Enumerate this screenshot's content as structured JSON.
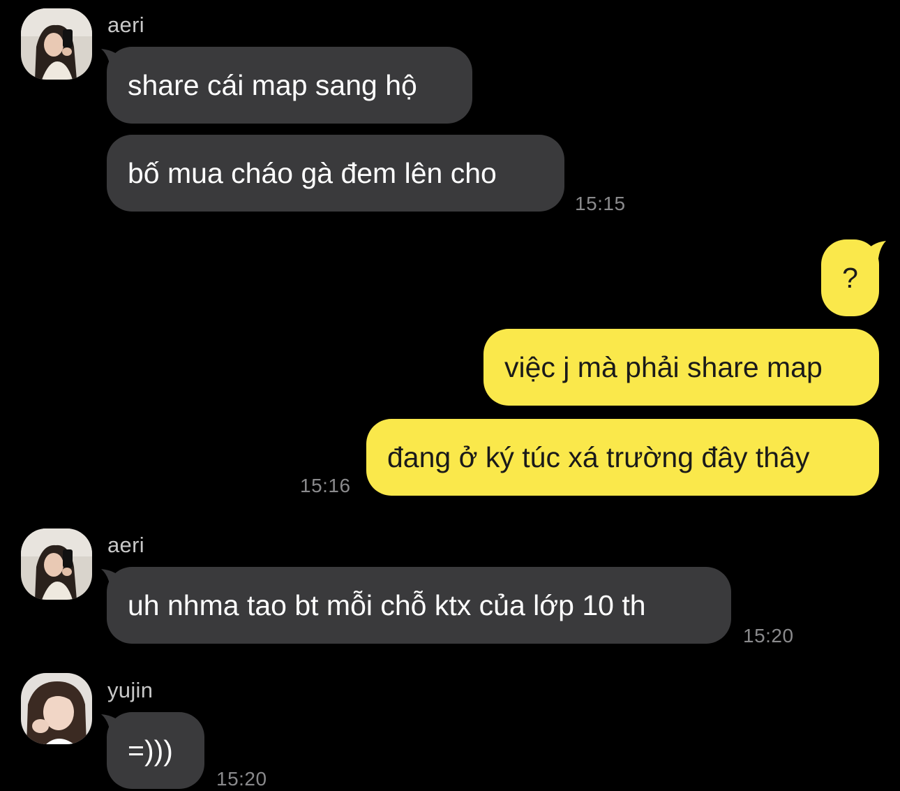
{
  "colors": {
    "background": "#000000",
    "incoming_bubble": "#3a3a3c",
    "outgoing_bubble": "#fae84b",
    "timestamp": "#8a8a8c",
    "sender_name": "#c8c8c8"
  },
  "groups": [
    {
      "sender": "aeri",
      "avatar_icon": "user-avatar-photo",
      "messages": [
        "share cái map sang hộ",
        "bố mua cháo gà đem lên cho"
      ],
      "time": "15:15"
    },
    {
      "sender": "me",
      "messages": [
        "?",
        "việc j mà phải share map",
        "đang ở ký túc xá trường đây thây"
      ],
      "time": "15:16"
    },
    {
      "sender": "aeri",
      "avatar_icon": "user-avatar-photo",
      "messages": [
        "uh nhma tao bt mỗi chỗ ktx của lớp 10 th"
      ],
      "time": "15:20"
    },
    {
      "sender": "yujin",
      "avatar_icon": "user-avatar-photo",
      "messages": [
        "=)))"
      ],
      "time": "15:20"
    }
  ]
}
